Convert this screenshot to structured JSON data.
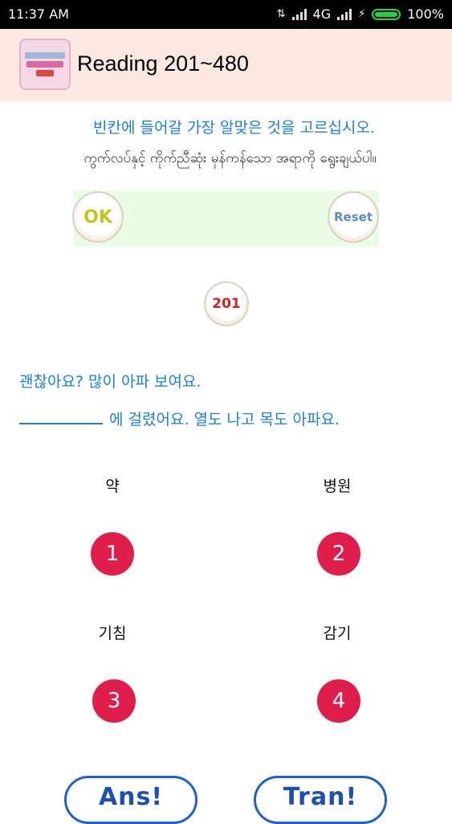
{
  "status": {
    "time": "11:37 AM",
    "network": "4G",
    "battery": "100%"
  },
  "app": {
    "title": "Reading 201~480"
  },
  "instructions": {
    "korean": "빈칸에 들어갈 가장 알맞은 것을 고르십시오.",
    "myanmar": "ကွက်လပ်နှင့် ကိုက်ညီဆုံး မှန်ကန်သော အရာကို ရွေးချယ်ပါ။"
  },
  "buttons": {
    "ok": "OK",
    "reset": "Reset",
    "answer": "Ans!",
    "translate": "Tran!"
  },
  "question": {
    "number": "201",
    "line1": "괜찮아요? 많이 아파 보여요.",
    "line2": "에 걸렸어요. 열도 나고 목도 아파요."
  },
  "options": [
    {
      "num": "1",
      "label": "약"
    },
    {
      "num": "2",
      "label": "병원"
    },
    {
      "num": "3",
      "label": "기침"
    },
    {
      "num": "4",
      "label": "감기"
    }
  ],
  "colors": {
    "accent": "#1f7fcf",
    "option": "#e01e4c",
    "appbar": "#fbe9e1"
  }
}
